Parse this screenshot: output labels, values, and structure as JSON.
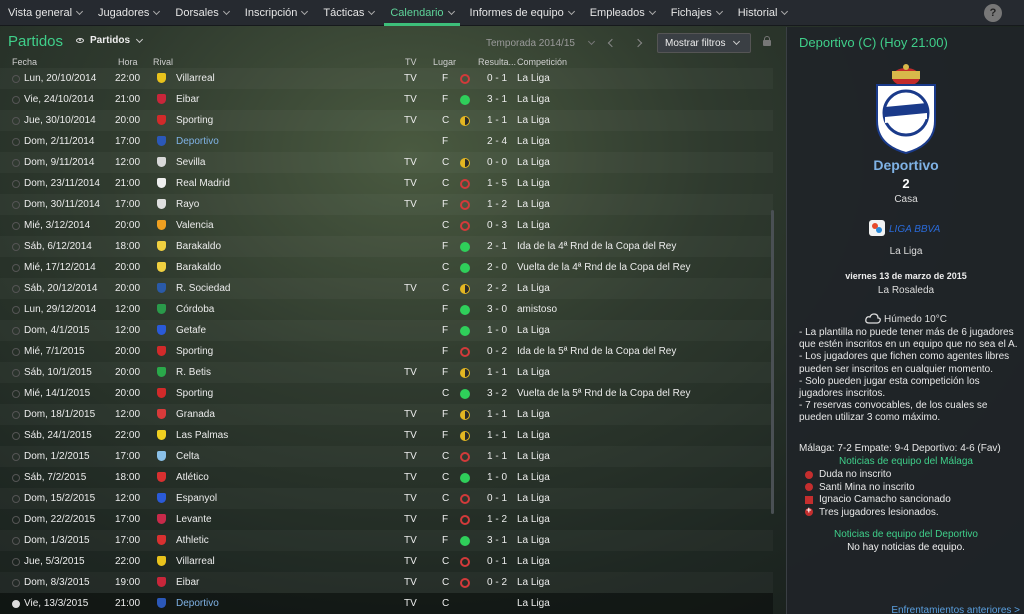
{
  "nav": {
    "items": [
      {
        "label": "Vista general",
        "dd": true
      },
      {
        "label": "Jugadores",
        "dd": true
      },
      {
        "label": "Dorsales",
        "dd": true
      },
      {
        "label": "Inscripción",
        "dd": true
      },
      {
        "label": "Tácticas",
        "dd": true
      },
      {
        "label": "Calendario",
        "dd": true,
        "active": true
      },
      {
        "label": "Informes de equipo",
        "dd": true
      },
      {
        "label": "Empleados",
        "dd": true
      },
      {
        "label": "Fichajes",
        "dd": true
      },
      {
        "label": "Historial",
        "dd": true
      }
    ],
    "help": "?"
  },
  "subhead": {
    "title": "Partidos",
    "view": "Partidos",
    "season": "Temporada 2014/15",
    "filters": "Mostrar filtros"
  },
  "table": {
    "headers": {
      "date": "Fecha",
      "time": "Hora",
      "rival": "Rival",
      "tv": "TV",
      "venue": "Lugar",
      "result": "Resulta...",
      "comp": "Competición"
    },
    "rows": [
      {
        "date": "Lun, 20/10/2014",
        "time": "22:00",
        "rival": "Villarreal",
        "crest": "#e8c21c",
        "tv": "TV",
        "venue": "F",
        "res": "loss",
        "score": "0 - 1",
        "comp": "La Liga"
      },
      {
        "date": "Vie, 24/10/2014",
        "time": "21:00",
        "rival": "Eibar",
        "crest": "#c8263a",
        "tv": "TV",
        "venue": "F",
        "res": "win",
        "score": "3 - 1",
        "comp": "La Liga"
      },
      {
        "date": "Jue, 30/10/2014",
        "time": "20:00",
        "rival": "Sporting",
        "crest": "#d12a2a",
        "tv": "TV",
        "venue": "C",
        "res": "draw",
        "score": "1 - 1",
        "comp": "La Liga"
      },
      {
        "date": "Dom, 2/11/2014",
        "time": "17:00",
        "rival": "Deportivo",
        "crest": "#2b58b8",
        "tv": "",
        "venue": "F",
        "res": "",
        "score": "2 - 4",
        "comp": "La Liga",
        "link": true
      },
      {
        "date": "Dom, 9/11/2014",
        "time": "12:00",
        "rival": "Sevilla",
        "crest": "#d8d8d8",
        "tv": "TV",
        "venue": "C",
        "res": "draw",
        "score": "0 - 0",
        "comp": "La Liga"
      },
      {
        "date": "Dom, 23/11/2014",
        "time": "21:00",
        "rival": "Real Madrid",
        "crest": "#efefef",
        "tv": "TV",
        "venue": "C",
        "res": "loss",
        "score": "1 - 5",
        "comp": "La Liga"
      },
      {
        "date": "Dom, 30/11/2014",
        "time": "17:00",
        "rival": "Rayo",
        "crest": "#e0e0e0",
        "tv": "TV",
        "venue": "F",
        "res": "loss",
        "score": "1 - 2",
        "comp": "La Liga"
      },
      {
        "date": "Mié, 3/12/2014",
        "time": "20:00",
        "rival": "Valencia",
        "crest": "#f0a020",
        "tv": "",
        "venue": "C",
        "res": "loss",
        "score": "0 - 3",
        "comp": "La Liga"
      },
      {
        "date": "Sáb, 6/12/2014",
        "time": "18:00",
        "rival": "Barakaldo",
        "crest": "#f0d040",
        "tv": "",
        "venue": "F",
        "res": "win",
        "score": "2 - 1",
        "comp": "Ida de la 4ª Rnd de la Copa del Rey"
      },
      {
        "date": "Mié, 17/12/2014",
        "time": "20:00",
        "rival": "Barakaldo",
        "crest": "#f0d040",
        "tv": "",
        "venue": "C",
        "res": "win",
        "score": "2 - 0",
        "comp": "Vuelta de la 4ª Rnd de la Copa del Rey"
      },
      {
        "date": "Sáb, 20/12/2014",
        "time": "20:00",
        "rival": "R. Sociedad",
        "crest": "#2a5aa8",
        "tv": "TV",
        "venue": "C",
        "res": "draw",
        "score": "2 - 2",
        "comp": "La Liga"
      },
      {
        "date": "Lun, 29/12/2014",
        "time": "12:00",
        "rival": "Córdoba",
        "crest": "#2a9a4a",
        "tv": "",
        "venue": "F",
        "res": "win",
        "score": "3 - 0",
        "comp": "amistoso"
      },
      {
        "date": "Dom, 4/1/2015",
        "time": "12:00",
        "rival": "Getafe",
        "crest": "#2a5ad8",
        "tv": "",
        "venue": "F",
        "res": "win",
        "score": "1 - 0",
        "comp": "La Liga"
      },
      {
        "date": "Mié, 7/1/2015",
        "time": "20:00",
        "rival": "Sporting",
        "crest": "#d12a2a",
        "tv": "",
        "venue": "F",
        "res": "loss",
        "score": "0 - 2",
        "comp": "Ida de la 5ª Rnd de la Copa del Rey"
      },
      {
        "date": "Sáb, 10/1/2015",
        "time": "20:00",
        "rival": "R. Betis",
        "crest": "#2aa84a",
        "tv": "TV",
        "venue": "F",
        "res": "draw",
        "score": "1 - 1",
        "comp": "La Liga"
      },
      {
        "date": "Mié, 14/1/2015",
        "time": "20:00",
        "rival": "Sporting",
        "crest": "#d12a2a",
        "tv": "",
        "venue": "C",
        "res": "win",
        "score": "3 - 2",
        "comp": "Vuelta de la 5ª Rnd de la Copa del Rey"
      },
      {
        "date": "Dom, 18/1/2015",
        "time": "12:00",
        "rival": "Granada",
        "crest": "#d83a3a",
        "tv": "TV",
        "venue": "F",
        "res": "draw",
        "score": "1 - 1",
        "comp": "La Liga"
      },
      {
        "date": "Sáb, 24/1/2015",
        "time": "22:00",
        "rival": "Las Palmas",
        "crest": "#f0d020",
        "tv": "TV",
        "venue": "F",
        "res": "draw",
        "score": "1 - 1",
        "comp": "La Liga"
      },
      {
        "date": "Dom, 1/2/2015",
        "time": "17:00",
        "rival": "Celta",
        "crest": "#8ac0e8",
        "tv": "TV",
        "venue": "C",
        "res": "loss",
        "score": "1 - 1",
        "comp": "La Liga"
      },
      {
        "date": "Sáb, 7/2/2015",
        "time": "18:00",
        "rival": "Atlético",
        "crest": "#d83030",
        "tv": "TV",
        "venue": "C",
        "res": "win",
        "score": "1 - 0",
        "comp": "La Liga"
      },
      {
        "date": "Dom, 15/2/2015",
        "time": "12:00",
        "rival": "Espanyol",
        "crest": "#2a5ad8",
        "tv": "TV",
        "venue": "C",
        "res": "loss",
        "score": "0 - 1",
        "comp": "La Liga"
      },
      {
        "date": "Dom, 22/2/2015",
        "time": "17:00",
        "rival": "Levante",
        "crest": "#c82a4a",
        "tv": "TV",
        "venue": "F",
        "res": "loss",
        "score": "1 - 2",
        "comp": "La Liga"
      },
      {
        "date": "Dom, 1/3/2015",
        "time": "17:00",
        "rival": "Athletic",
        "crest": "#d83030",
        "tv": "TV",
        "venue": "F",
        "res": "win",
        "score": "3 - 1",
        "comp": "La Liga"
      },
      {
        "date": "Jue, 5/3/2015",
        "time": "22:00",
        "rival": "Villarreal",
        "crest": "#e8c21c",
        "tv": "TV",
        "venue": "C",
        "res": "loss",
        "score": "0 - 1",
        "comp": "La Liga"
      },
      {
        "date": "Dom, 8/3/2015",
        "time": "19:00",
        "rival": "Eibar",
        "crest": "#c8263a",
        "tv": "TV",
        "venue": "C",
        "res": "loss",
        "score": "0 - 2",
        "comp": "La Liga"
      },
      {
        "date": "Vie, 13/3/2015",
        "time": "21:00",
        "rival": "Deportivo",
        "crest": "#2b58b8",
        "tv": "TV",
        "venue": "C",
        "res": "",
        "score": "",
        "comp": "La Liga",
        "link": true,
        "current": true
      }
    ]
  },
  "panel": {
    "title": "Deportivo (C) (Hoy 21:00)",
    "club_name": "Deportivo",
    "position": "2",
    "venue_type": "Casa",
    "league_logo_text": "LIGA BBVA",
    "league_name": "La Liga",
    "date": "viernes 13 de marzo de 2015",
    "stadium": "La Rosaleda",
    "weather": "Húmedo 10°C",
    "rules": [
      "- La plantilla no puede tener más de 6 jugadores que estén inscritos en un equipo que no sea el A.",
      "- Los jugadores que fichen como agentes libres pueden ser inscritos en cualquier momento.",
      "- Solo pueden jugar esta competición los jugadores inscritos.",
      "- 7 reservas convocables, de los cuales se pueden utilizar 3 como máximo."
    ],
    "odds": "Málaga: 7-2 Empate: 9-4 Deportivo: 4-6 (Fav)",
    "team_news_title": "Noticias de equipo del Málaga",
    "team_news": [
      {
        "text": "Duda no inscrito",
        "icon": "doubt"
      },
      {
        "text": "Santi Mina no inscrito",
        "icon": "doubt"
      },
      {
        "text": "Ignacio Camacho sancionado",
        "icon": "sq"
      },
      {
        "text": "Tres jugadores lesionados.",
        "icon": "plus"
      }
    ],
    "dep_news_title": "Noticias de equipo del Deportivo",
    "dep_news": "No hay noticias de equipo.",
    "prev_link": "Enfrentamientos anteriores >"
  }
}
